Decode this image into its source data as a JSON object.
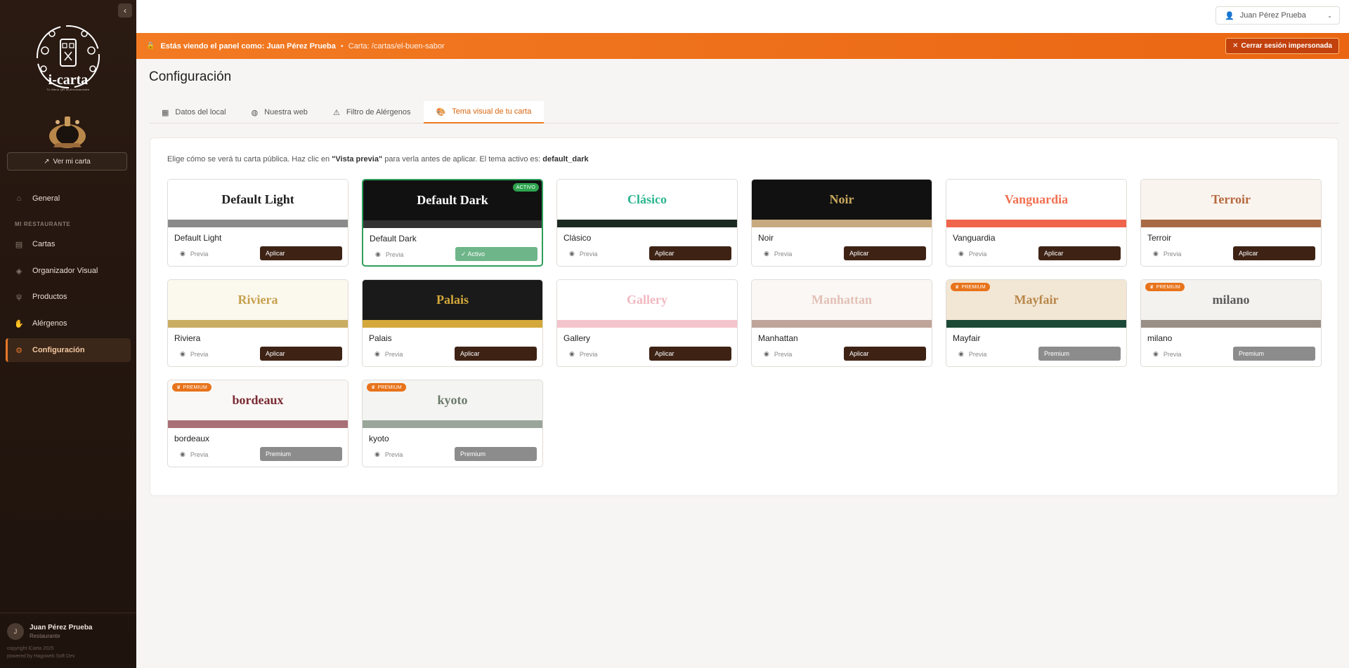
{
  "sidebar": {
    "logo_text": "i-carta",
    "logo_sub": "Tu Menú QR Multirestaurante",
    "ver_carta": "Ver mi carta",
    "section_label": "MI RESTAURANTE",
    "nav": [
      {
        "label": "General",
        "icon": "home-icon"
      },
      {
        "label": "Cartas",
        "icon": "book-icon"
      },
      {
        "label": "Organizador Visual",
        "icon": "layers-icon"
      },
      {
        "label": "Productos",
        "icon": "utensils-icon"
      },
      {
        "label": "Alérgenos",
        "icon": "hand-icon"
      },
      {
        "label": "Configuración",
        "icon": "cogs-icon"
      }
    ],
    "user": {
      "initial": "J",
      "name": "Juan Pérez Prueba",
      "role": "Restaurante",
      "copyright": "copyright iCarta 2025",
      "powered": "powered by Hagoweb Soft Dev"
    }
  },
  "topbar": {
    "user_name": "Juan Pérez Prueba"
  },
  "banner": {
    "prefix": "Estás viendo el panel como:",
    "user": "Juan Pérez Prueba",
    "separator": "•",
    "carta": "Carta: /cartas/el-buen-sabor",
    "close_label": "Cerrar sesión impersonada"
  },
  "page": {
    "title": "Configuración",
    "tabs": [
      {
        "label": "Datos del local",
        "icon": "store-icon"
      },
      {
        "label": "Nuestra web",
        "icon": "globe-icon"
      },
      {
        "label": "Filtro de Alérgenos",
        "icon": "warning-icon"
      },
      {
        "label": "Tema visual de tu carta",
        "icon": "palette-icon"
      }
    ],
    "active_tab": 3
  },
  "themes_panel": {
    "intro_start": "Elige cómo se verá tu carta pública. Haz clic en",
    "intro_bold": "\"Vista previa\"",
    "intro_mid": "para verla antes de aplicar. El tema activo es:",
    "active_theme": "default_dark",
    "previa_label": "Previa",
    "badge_activo": "ACTIVO",
    "badge_premium": "PREMIUM",
    "themes": [
      {
        "name": "Default Light",
        "bg": "#ffffff",
        "fg": "#1f1f1f",
        "stripe": "#8a8a8a",
        "button": "Aplicar",
        "state": "normal"
      },
      {
        "name": "Default Dark",
        "bg": "#111111",
        "fg": "#ffffff",
        "stripe": "#333333",
        "button": "✓ Activo",
        "state": "active"
      },
      {
        "name": "Clásico",
        "bg": "#ffffff",
        "fg": "#2bb58f",
        "stripe": "#1b2a22",
        "button": "Aplicar",
        "state": "normal"
      },
      {
        "name": "Noir",
        "bg": "#111111",
        "fg": "#c9a95f",
        "stripe": "#c8aa80",
        "button": "Aplicar",
        "state": "normal"
      },
      {
        "name": "Vanguardia",
        "bg": "#ffffff",
        "fg": "#f07050",
        "stripe": "#f0644c",
        "button": "Aplicar",
        "state": "normal"
      },
      {
        "name": "Terroir",
        "bg": "#faf4ee",
        "fg": "#b5683d",
        "stripe": "#a86a45",
        "button": "Aplicar",
        "state": "normal"
      },
      {
        "name": "Riviera",
        "bg": "#fbf8ee",
        "fg": "#c6a04c",
        "stripe": "#c9ad62",
        "button": "Aplicar",
        "state": "normal"
      },
      {
        "name": "Palais",
        "bg": "#1a1a1a",
        "fg": "#d4a83a",
        "stripe": "#d4a83a",
        "button": "Aplicar",
        "state": "normal"
      },
      {
        "name": "Gallery",
        "bg": "#ffffff",
        "fg": "#f0b8c0",
        "stripe": "#f4c4cc",
        "button": "Aplicar",
        "state": "normal"
      },
      {
        "name": "Manhattan",
        "bg": "#faf7f4",
        "fg": "#e3c0b6",
        "stripe": "#bfa49a",
        "button": "Aplicar",
        "state": "normal"
      },
      {
        "name": "Mayfair",
        "bg": "#f2e6d4",
        "fg": "#b8874a",
        "stripe": "#1c4a36",
        "button": "Premium",
        "state": "premium"
      },
      {
        "name": "milano",
        "bg": "#f4f2ee",
        "fg": "#5a5a5a",
        "stripe": "#9a8f86",
        "button": "Premium",
        "state": "premium"
      },
      {
        "name": "bordeaux",
        "bg": "#faf8f6",
        "fg": "#7a2a34",
        "stripe": "#a87076",
        "button": "Premium",
        "state": "premium"
      },
      {
        "name": "kyoto",
        "bg": "#f4f4f2",
        "fg": "#6a7a6a",
        "stripe": "#9aa69a",
        "button": "Premium",
        "state": "premium"
      }
    ]
  },
  "colors": {
    "accent": "#ea7a1e",
    "sidebar_bg": "#2a1a12",
    "apply_btn": "#3e2315",
    "active_green": "#2e9e5a"
  }
}
